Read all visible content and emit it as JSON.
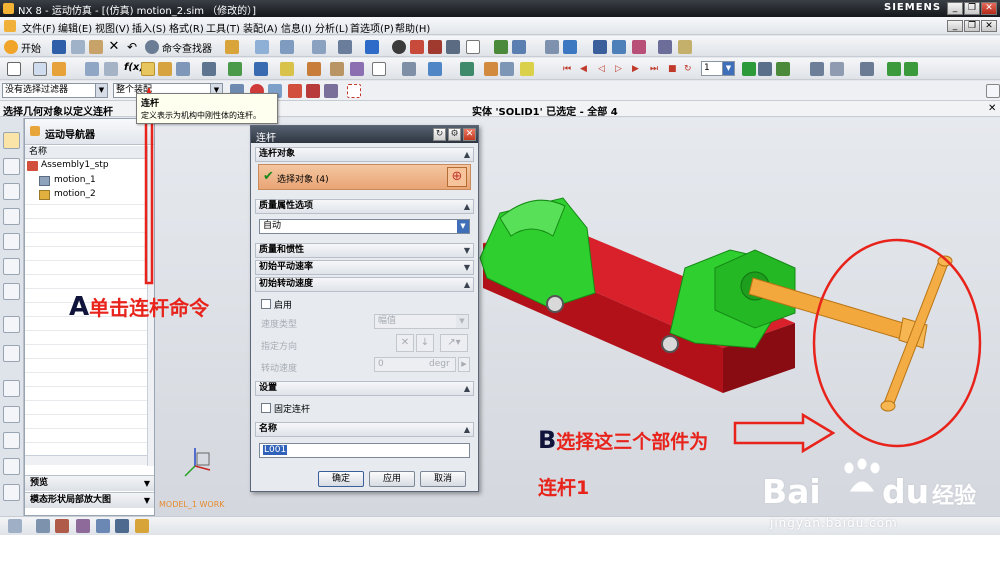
{
  "titlebar": {
    "title": "NX 8 - 运动仿真 - [(仿真) motion_2.sim （修改的）]",
    "brand": "SIEMENS",
    "minimize": "_",
    "restore": "❐",
    "close": "✕"
  },
  "menubar": {
    "items": [
      "文件(F)",
      "编辑(E)",
      "视图(V)",
      "插入(S)",
      "格式(R)",
      "工具(T)",
      "装配(A)",
      "信息(I)",
      "分析(L)",
      "首选项(P)",
      "帮助(H)"
    ]
  },
  "toolbar1": {
    "start_label": "开始",
    "command_finder_label": "命令查找器"
  },
  "toolbar2": {
    "fx_label": "f(x)",
    "frame_value": "1"
  },
  "selection_bar": {
    "filter_value": "没有选择过滤器",
    "scope_value": "整个装配"
  },
  "cue_line": {
    "prompt": "选择几何对象以定义连杆",
    "status": "实体 'SOLID1' 已选定 - 全部 4"
  },
  "tooltip": {
    "title": "连杆",
    "description": "定义表示为机构中刚性体的连杆。"
  },
  "navigator": {
    "title": "运动导航器",
    "column_header": "名称",
    "items": [
      "Assembly1_stp",
      "motion_1",
      "motion_2"
    ],
    "footer_preview": "预览",
    "footer_modal": "模态形状局部放大图"
  },
  "viewport": {
    "work_label": "MODEL_1 WORK"
  },
  "dialog": {
    "title": "连杆",
    "sec_link_object": "连杆对象",
    "select_object": "选择对象 (4)",
    "sec_mass_option": "质量属性选项",
    "mass_value": "自动",
    "sec_mass_inertia": "质量和惯性",
    "sec_init_translate": "初始平动速率",
    "sec_init_rotate": "初始转动速度",
    "enable_label": "启用",
    "speed_type_label": "速度类型",
    "speed_type_value": "幅值",
    "direction_label": "指定方向",
    "rot_speed_label": "转动速度",
    "rot_speed_value": "0",
    "rot_speed_unit": "degr",
    "sec_settings": "设置",
    "fixed_link_label": "固定连杆",
    "sec_name": "名称",
    "name_value": "L001",
    "ok": "确定",
    "apply": "应用",
    "cancel": "取消"
  },
  "annotations": {
    "a_letter": "A",
    "a_text": "单击连杆命令",
    "b_letter": "B",
    "b_text_line1": "选择这三个部件为",
    "b_text_line2": "连杆1"
  },
  "watermark": {
    "brand": "Bai",
    "brand2": "du",
    "jingyan": "经验",
    "url": "jingyan.baidu.com"
  },
  "colors": {
    "annotation_red": "#e8231b",
    "part_green": "#2fcf2f",
    "base_red": "#c2141b",
    "screw_orange": "#f2a83c",
    "select_orange": "#eba679"
  }
}
